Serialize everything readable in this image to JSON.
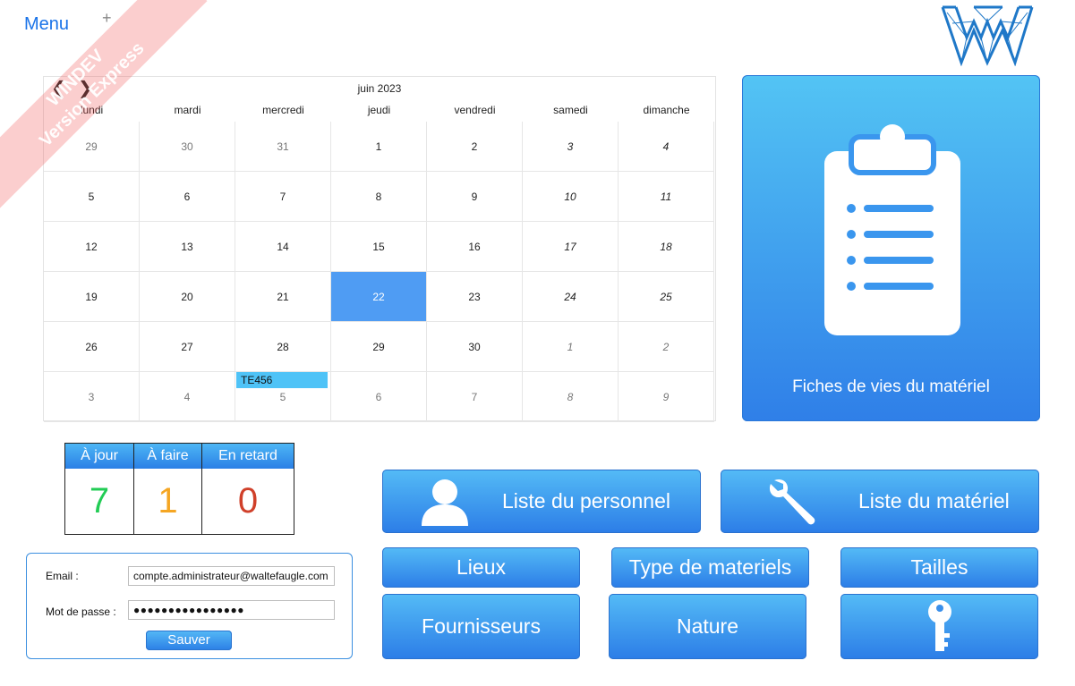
{
  "menu": {
    "label": "Menu",
    "plus": "+"
  },
  "watermark": {
    "line1": "WINDEV",
    "line2": "Version Express"
  },
  "calendar": {
    "title": "juin 2023",
    "weekdays": [
      "lundi",
      "mardi",
      "mercredi",
      "jeudi",
      "vendredi",
      "samedi",
      "dimanche"
    ],
    "weeks": [
      [
        "29",
        "30",
        "31",
        "1",
        "2",
        "3",
        "4"
      ],
      [
        "5",
        "6",
        "7",
        "8",
        "9",
        "10",
        "11"
      ],
      [
        "12",
        "13",
        "14",
        "15",
        "16",
        "17",
        "18"
      ],
      [
        "19",
        "20",
        "21",
        "22",
        "23",
        "24",
        "25"
      ],
      [
        "26",
        "27",
        "28",
        "29",
        "30",
        "1",
        "2"
      ],
      [
        "3",
        "4",
        "5",
        "6",
        "7",
        "8",
        "9"
      ]
    ],
    "selected": "22",
    "event_label": "TE456"
  },
  "tile": {
    "label": "Fiches de vies du matériel"
  },
  "status": {
    "headers": [
      "À jour",
      "À faire",
      "En retard"
    ],
    "values": [
      "7",
      "1",
      "0"
    ],
    "colors": [
      "#22cc55",
      "#f5a623",
      "#d0402a"
    ]
  },
  "login": {
    "email_label": "Email :",
    "email_value": "compte.administrateur@waltefaugle.com",
    "password_label": "Mot de passe :",
    "password_value": "●●●●●●●●●●●●●●●●",
    "save_label": "Sauver"
  },
  "buttons": {
    "personnel": "Liste du personnel",
    "materiel": "Liste du matériel",
    "lieux": "Lieux",
    "type": "Type de materiels",
    "tailles": "Tailles",
    "fournisseurs": "Fournisseurs",
    "nature": "Nature"
  },
  "icons": {
    "user": "user-icon",
    "wrench": "wrench-icon",
    "key": "key-icon",
    "clipboard": "clipboard-icon",
    "logo": "windev-logo"
  },
  "accent": "#2f7fe8"
}
